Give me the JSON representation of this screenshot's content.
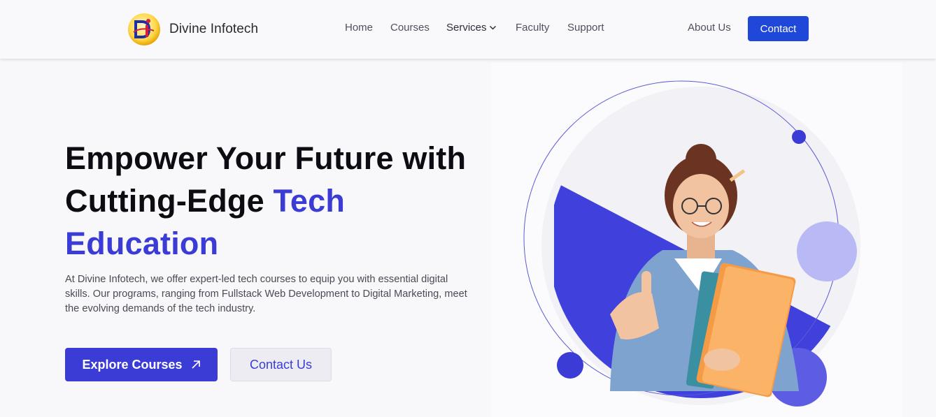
{
  "header": {
    "brand": "Divine Infotech",
    "logo_text": "DI",
    "nav": {
      "home": "Home",
      "courses": "Courses",
      "services": "Services",
      "faculty": "Faculty",
      "support": "Support",
      "about": "About Us"
    },
    "contact_label": "Contact"
  },
  "hero": {
    "title_line1": "Empower Your Future with",
    "title_line2_plain": "Cutting-Edge ",
    "title_line2_accent": "Tech",
    "title_line3_accent": "Education",
    "description": "At Divine Infotech, we offer expert-led tech courses to equip you with essential digital skills. Our programs, ranging from Fullstack Web Development to Digital Marketing, meet the evolving demands of the tech industry.",
    "primary_button": "Explore Courses",
    "secondary_button": "Contact Us"
  },
  "colors": {
    "accent": "#3b3bd6",
    "nav_button": "#1f47d8",
    "background": "#f8f8fb"
  }
}
